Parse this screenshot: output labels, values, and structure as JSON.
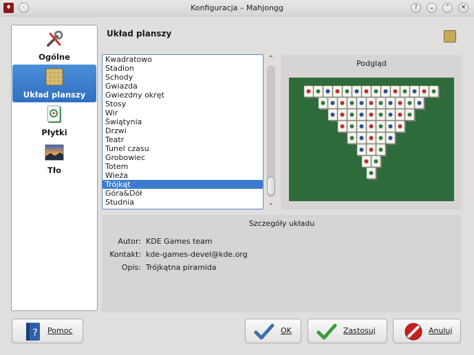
{
  "window": {
    "title": "Konfiguracja – Mahjongg"
  },
  "sidebar": {
    "items": [
      {
        "label": "Ogólne",
        "icon": "tools-icon",
        "selected": false
      },
      {
        "label": "Układ planszy",
        "icon": "board-layout-icon",
        "selected": true
      },
      {
        "label": "Płytki",
        "icon": "mahjong-tile-icon",
        "selected": false
      },
      {
        "label": "Tło",
        "icon": "landscape-icon",
        "selected": false
      }
    ]
  },
  "main": {
    "section_title": "Układ planszy",
    "layouts": [
      "Kwadratowo",
      "Stadion",
      "Schody",
      "Gwiazda",
      "Gwiezdny okręt",
      "Stosy",
      "Wir",
      "Świątynia",
      "Drzwi",
      "Teatr",
      "Tunel czasu",
      "Grobowiec",
      "Totem",
      "Wieża",
      "Trójkąt",
      "Góra&Dół",
      "Studnia"
    ],
    "selected_layout": "Trójkąt",
    "preview_title": "Podgląd",
    "details": {
      "title": "Szczegóły układu",
      "author_label": "Autor:",
      "author": "KDE Games team",
      "contact_label": "Kontakt:",
      "contact": "kde-games-devel@kde.org",
      "desc_label": "Opis:",
      "desc": "Trójkątna piramida"
    }
  },
  "buttons": {
    "help": "Pomoc",
    "ok": "OK",
    "apply": "Zastosuj",
    "cancel": "Anuluj"
  },
  "colors": {
    "selection": "#3d7bd0",
    "felt": "#2e6b3a"
  }
}
